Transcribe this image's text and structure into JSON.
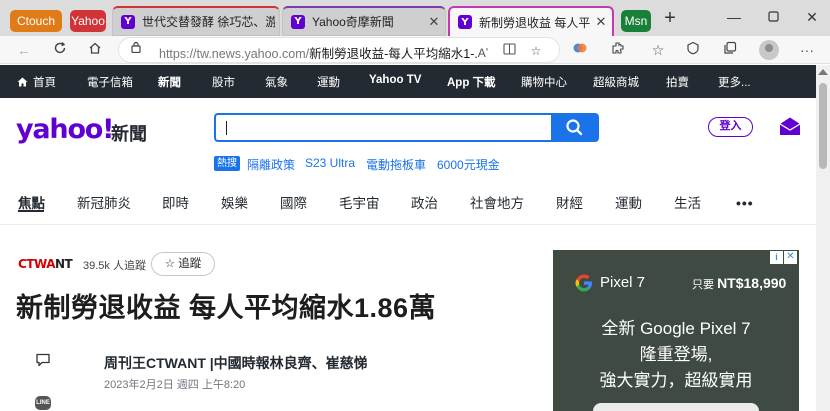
{
  "browser": {
    "tab_groups": [
      "Ctouch",
      "Yahoo",
      "Msn"
    ],
    "tabs": [
      {
        "title": "世代交替發酵 徐巧芯、游"
      },
      {
        "title": "Yahoo奇摩新聞"
      },
      {
        "title": "新制勞退收益 每人平均縮"
      }
    ],
    "url_domain": "https://tw.news.yahoo.com/",
    "url_path": "新制勞退收益-每人平均縮水1-..."
  },
  "yahoo_nav": [
    {
      "label": "首頁"
    },
    {
      "label": "電子信箱"
    },
    {
      "label": "新聞"
    },
    {
      "label": "股市"
    },
    {
      "label": "氣象"
    },
    {
      "label": "運動"
    },
    {
      "label": "Yahoo TV"
    },
    {
      "label": "App 下載"
    },
    {
      "label": "購物中心"
    },
    {
      "label": "超級商城"
    },
    {
      "label": "拍賣"
    },
    {
      "label": "更多..."
    }
  ],
  "header": {
    "logo": "yahoo!",
    "logo_sub": "新聞",
    "search_value": "",
    "login_label": "登入"
  },
  "trending": {
    "hot_label": "熱搜",
    "items": [
      "隔離政策",
      "S23 Ultra",
      "電動拖板車",
      "6000元現金"
    ]
  },
  "categories": [
    "焦點",
    "新冠肺炎",
    "即時",
    "娛樂",
    "國際",
    "毛宇宙",
    "政治",
    "社會地方",
    "財經",
    "運動",
    "生活"
  ],
  "article": {
    "source_red": "CTWA",
    "source_dark": "NT",
    "followers": "39.5k 人追蹤",
    "follow_label": "☆ 追蹤",
    "title": "新制勞退收益 每人平均縮水1.86萬",
    "author": "周刊王CTWANT |中國時報林良齊、崔慈悌",
    "date": "2023年2月2日 週四 上午8:20",
    "share_line": "LINE"
  },
  "ad": {
    "product": "Pixel 7",
    "price_prefix": "只要 ",
    "price": "NT$18,990",
    "line1": "全新 Google Pixel 7",
    "line2": "隆重登場,",
    "line3": "強大實力，超級實用"
  }
}
